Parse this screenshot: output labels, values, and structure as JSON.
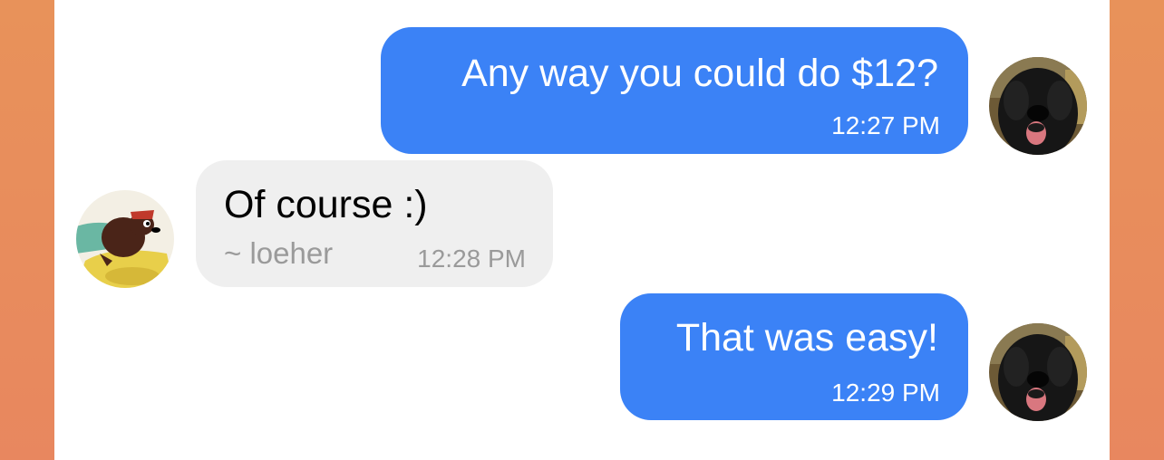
{
  "messages": [
    {
      "direction": "outgoing",
      "text": "Any way you could do $12?",
      "time": "12:27 PM",
      "avatar": "black-dog-avatar"
    },
    {
      "direction": "incoming",
      "text": "Of course :)",
      "sender": "~ loeher",
      "time": "12:28 PM",
      "avatar": "cartoon-dog-driver-avatar"
    },
    {
      "direction": "outgoing",
      "text": "That was easy!",
      "time": "12:29 PM",
      "avatar": "black-dog-avatar"
    }
  ],
  "colors": {
    "outgoing_bubble": "#3b82f6",
    "incoming_bubble": "#efefef",
    "background_orange": "#e8925a",
    "panel": "#ffffff"
  }
}
